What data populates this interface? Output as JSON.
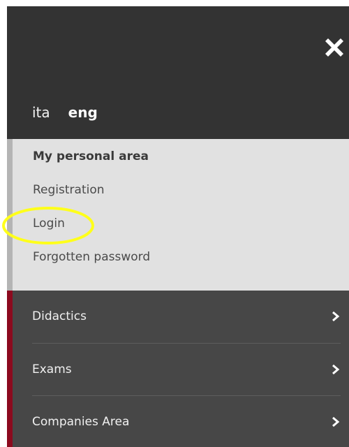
{
  "header": {
    "close_icon": "close-icon",
    "languages": [
      {
        "label": "ita",
        "active": false
      },
      {
        "label": "eng",
        "active": true
      }
    ]
  },
  "personal_area": {
    "title": "My personal area",
    "links": [
      {
        "label": "Registration"
      },
      {
        "label": "Login",
        "highlighted": true
      },
      {
        "label": "Forgotten password"
      }
    ]
  },
  "menu": {
    "items": [
      {
        "label": "Didactics",
        "icon": "chevron-right-icon"
      },
      {
        "label": "Exams",
        "icon": "chevron-right-icon"
      },
      {
        "label": "Companies Area",
        "icon": "chevron-right-icon"
      }
    ]
  },
  "colors": {
    "panel_bg": "#333333",
    "personal_area_bg": "#e1e1e1",
    "menu_bg": "#474747",
    "accent_red": "#8c0a1e",
    "highlight_yellow": "#ffff1a"
  }
}
